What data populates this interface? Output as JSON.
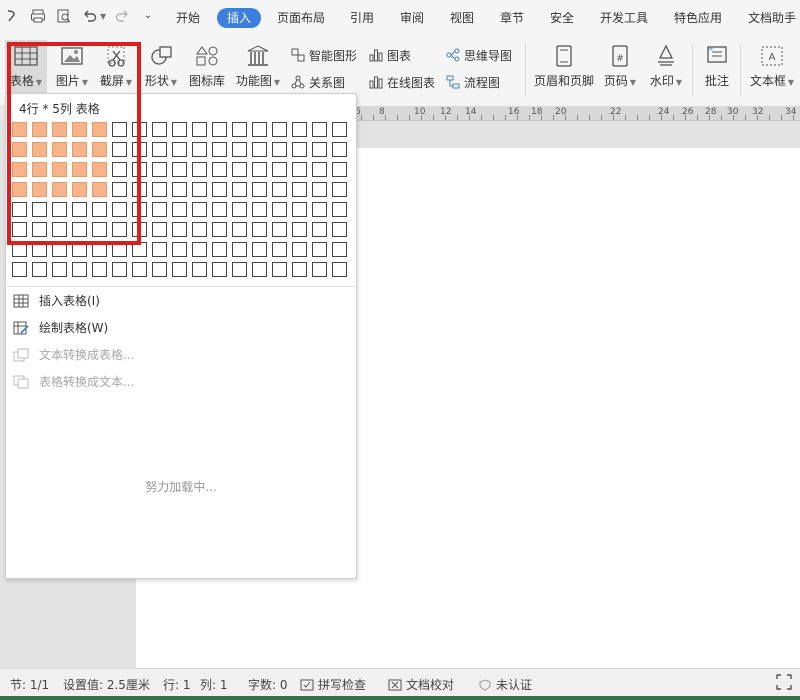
{
  "menu": {
    "quick_icons": [
      "wps-icon",
      "print-icon",
      "print-preview-icon",
      "undo-icon",
      "redo-icon",
      "customize-icon"
    ],
    "tabs": [
      {
        "label": "开始",
        "active": false
      },
      {
        "label": "插入",
        "active": true
      },
      {
        "label": "页面布局",
        "active": false
      },
      {
        "label": "引用",
        "active": false
      },
      {
        "label": "审阅",
        "active": false
      },
      {
        "label": "视图",
        "active": false
      },
      {
        "label": "章节",
        "active": false
      },
      {
        "label": "安全",
        "active": false
      },
      {
        "label": "开发工具",
        "active": false
      },
      {
        "label": "特色应用",
        "active": false
      },
      {
        "label": "文档助手",
        "active": false
      }
    ]
  },
  "ribbon": {
    "table": "表格",
    "picture": "图片",
    "screenshot": "截屏",
    "shape": "形状",
    "icon_lib": "图标库",
    "func_chart": "功能图",
    "smart_graphic": "智能图形",
    "chart": "图表",
    "mindmap": "思维导图",
    "relation": "关系图",
    "online_chart": "在线图表",
    "flowchart": "流程图",
    "header_footer": "页眉和页脚",
    "page_num": "页码",
    "watermark": "水印",
    "comment": "批注",
    "textbox": "文本框"
  },
  "ruler": {
    "numbers": [
      "6",
      "8",
      "10",
      "12",
      "14",
      "16",
      "18",
      "20",
      "22",
      "24",
      "26",
      "28",
      "30",
      "32",
      "34"
    ]
  },
  "dropdown": {
    "grid_label": "4行 * 5列 表格",
    "grid_rows": 8,
    "grid_cols": 17,
    "selected_rows": 4,
    "selected_cols": 5,
    "insert_table": "插入表格(I)",
    "draw_table": "绘制表格(W)",
    "text_to_table": "文本转换成表格...",
    "table_to_text": "表格转换成文本...",
    "loading": "努力加载中..."
  },
  "status": {
    "section": "节: 1/1",
    "setting": "设置值: 2.5厘米",
    "row": "行: 1",
    "col": "列: 1",
    "words": "字数: 0",
    "spell": "拼写检查",
    "proof": "文档校对",
    "auth": "未认证"
  },
  "colors": {
    "accent": "#3d7fe0",
    "highlight": "#e01d1d",
    "cell_selected": "#f7b48a"
  }
}
